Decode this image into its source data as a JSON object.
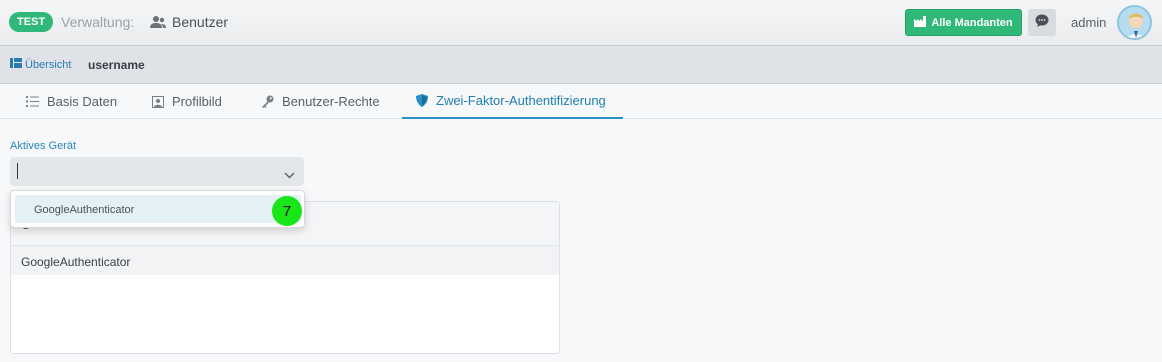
{
  "header": {
    "env_badge": "TEST",
    "crumb_prefix": "Verwaltung:",
    "crumb_title": "Benutzer",
    "mandanten_label": "Alle Mandanten",
    "user_name": "admin",
    "accent_green": "#2fb877"
  },
  "subbar": {
    "overview_label": "Übersicht",
    "username": "username"
  },
  "tabs": [
    {
      "label": "Basis Daten",
      "icon": "list-icon"
    },
    {
      "label": "Profilbild",
      "icon": "image-icon"
    },
    {
      "label": "Benutzer-Rechte",
      "icon": "key-icon"
    },
    {
      "label": "Zwei-Faktor-Authentifizierung",
      "icon": "shield-icon",
      "active": true
    }
  ],
  "form": {
    "device_label": "Aktives Gerät",
    "device_value": "",
    "options": [
      "GoogleAuthenticator"
    ]
  },
  "table": {
    "header_text": "G",
    "rows": [
      "GoogleAuthenticator"
    ]
  },
  "marker": {
    "number": "7"
  }
}
